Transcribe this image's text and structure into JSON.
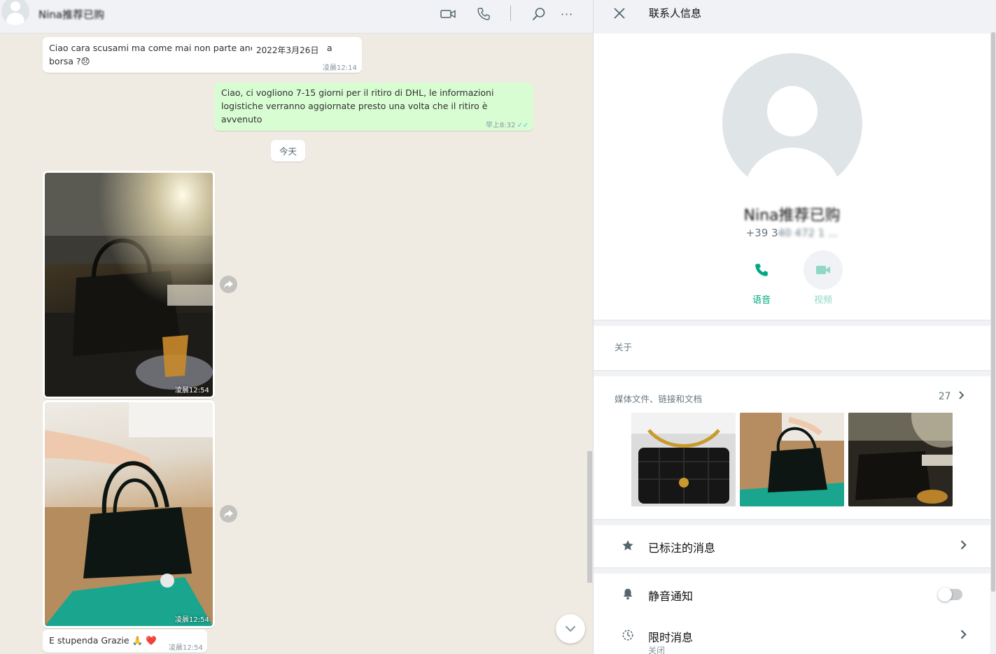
{
  "chat": {
    "header": {
      "contact_name": "Nina推荐已购",
      "icons": [
        "video-call-icon",
        "voice-call-icon",
        "search-icon",
        "more-options-icon"
      ],
      "more_glyph": "···"
    },
    "messages": [
      {
        "direction": "in",
        "text": "Ciao cara scusami ma come mai non parte anc",
        "text_tail": "a",
        "text_line2": "borsa ?",
        "emoji": "😞",
        "time": "凌晨12:14"
      },
      {
        "direction": "out",
        "text": "Ciao, ci vogliono 7-15 giorni per il ritiro di DHL, le informazioni logistiche verranno aggiornate presto una volta che il ritiro è avvenuto",
        "time": "早上8:32",
        "ticks": "✓✓"
      },
      {
        "direction": "in",
        "type": "photo",
        "time": "凌晨12:54"
      },
      {
        "direction": "in",
        "type": "photo",
        "time": "凌晨12:54"
      },
      {
        "direction": "in",
        "text": "E stupenda Grazie",
        "emoji": "🙏 ❤️",
        "time": "凌晨12:54"
      }
    ],
    "floating_date": "2022年3月26日",
    "date_separator": "今天"
  },
  "info": {
    "title": "联系人信息",
    "contact_name": "Nina推荐已购",
    "phone_visible": "+39 3",
    "phone_blurred": "40 472 1 ...",
    "voice_label": "语音",
    "video_label": "视频",
    "about_label": "关于",
    "media_label": "媒体文件、链接和文档",
    "media_count": "27",
    "starred_label": "已标注的消息",
    "mute_label": "静音通知",
    "disappearing_label": "限时消息",
    "disappearing_status": "关闭",
    "colors": {
      "accent": "#00a884",
      "video_muted": "#8ed8c5",
      "bubble_out": "#d9fdd3"
    }
  }
}
